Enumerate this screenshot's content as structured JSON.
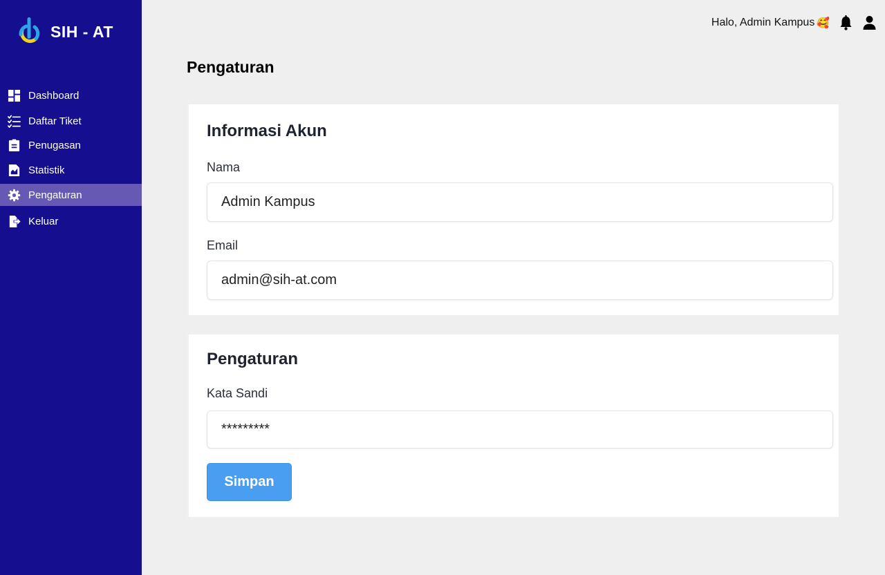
{
  "brand": {
    "name": "SIH - AT"
  },
  "sidebar": {
    "items": [
      {
        "label": "Dashboard",
        "icon": "dashboard-icon"
      },
      {
        "label": "Daftar Tiket",
        "icon": "checklist-icon"
      },
      {
        "label": "Penugasan",
        "icon": "clipboard-icon"
      },
      {
        "label": "Statistik",
        "icon": "chart-file-icon"
      },
      {
        "label": "Pengaturan",
        "icon": "gear-icon",
        "active": true
      },
      {
        "label": "Keluar",
        "icon": "logout-icon"
      }
    ]
  },
  "header": {
    "greeting": "Halo, Admin Kampus",
    "emoji": "🥰"
  },
  "page": {
    "title": "Pengaturan"
  },
  "account": {
    "title": "Informasi Akun",
    "name_label": "Nama",
    "name_value": "Admin Kampus",
    "email_label": "Email",
    "email_value": "admin@sih-at.com"
  },
  "settings": {
    "title": "Pengaturan",
    "password_label": "Kata Sandi",
    "password_value": "*********",
    "save_label": "Simpan"
  },
  "colors": {
    "sidebar_bg": "#150f8f",
    "sidebar_active": "#6559b3",
    "primary_button": "#4a9ef2",
    "page_bg": "#efefef"
  }
}
